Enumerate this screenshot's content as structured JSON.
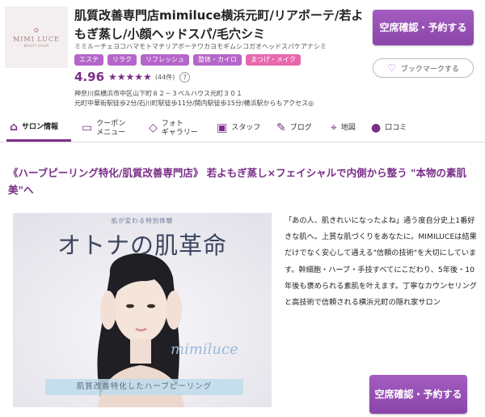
{
  "salon": {
    "logo_name": "MIMI LUCE",
    "logo_sub": "BEAUTY SALON",
    "title": "肌質改善専門店mimiluce横浜元町/リアボーテ/若よもぎ蒸し/小顔ヘッドスパ/毛穴シミ",
    "kana": "ミミルーチェヨコハマモトマチリアボーテワカヨモギムシコガオヘッドスパケアナシミ",
    "tags": [
      "エステ",
      "リラク",
      "リフレッシュ",
      "整体・カイロ",
      "まつげ・メイク"
    ],
    "rating": "4.96",
    "stars": "★★★★★",
    "review_count": "(44件)",
    "help": "?",
    "address": "神奈川県横浜市中区山下町８２－３ベルハウス元町３０１",
    "access": "元町中華街駅徒歩2分/石川町駅徒歩11分/関内駅徒歩15分/横浜駅からもアクセス◎"
  },
  "buttons": {
    "reserve": "空席確認・予約する",
    "bookmark": "ブックマークする",
    "reserve_bottom": "空席確認・予約する"
  },
  "tabs": [
    {
      "label": "サロン情報",
      "icon": "⌂"
    },
    {
      "label": "クーポン\nメニュー",
      "icon": "▭"
    },
    {
      "label": "フォト\nギャラリー",
      "icon": "◇"
    },
    {
      "label": "スタッフ",
      "icon": "▣"
    },
    {
      "label": "ブログ",
      "icon": "✎"
    },
    {
      "label": "地図",
      "icon": "⌖"
    },
    {
      "label": "口コミ",
      "icon": "●"
    }
  ],
  "content": {
    "heading": "《ハーブピーリング特化/肌質改善専門店》 若よもぎ蒸し×フェイシャルで内側から整う \"本物の素肌美\"へ",
    "hero_mini": "肌が変わる特別体験",
    "hero_title": "オトナの肌革命",
    "hero_script": "mimiluce",
    "hero_band": "肌質改善特化したハーブピーリング",
    "description": "「あの人、肌きれいになったよね」通う度自分史上1番好きな肌へ。上質な肌づくりをあなたに。MIMILUCEは結果だけでなく安心して通える\"信頼の技術\"を大切にしています。幹細胞・ハーブ・手技すべてにこだわり、5年後・10年後も褒められる素肌を叶えます。丁寧なカウンセリングと高技術で信頼される横浜元町の隠れ家サロン"
  },
  "colors": {
    "accent": "#7a2f88",
    "button": "#9c55b9",
    "tag": "#b565c9",
    "tag_pink": "#e868ae"
  }
}
